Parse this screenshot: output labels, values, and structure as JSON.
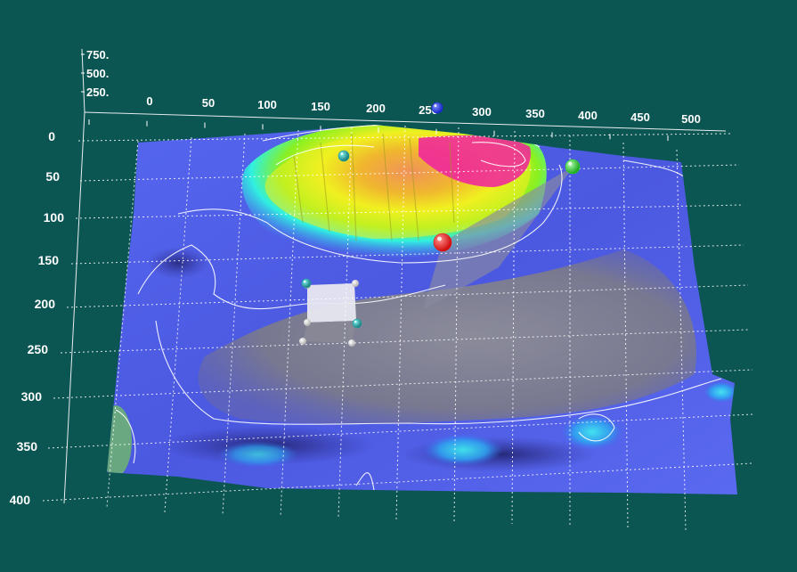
{
  "chart_data": {
    "type": "surface3d",
    "x_ticks": [
      "0",
      "50",
      "100",
      "150",
      "200",
      "250",
      "300",
      "350",
      "400",
      "450",
      "500"
    ],
    "y_ticks": [
      "0",
      "50",
      "100",
      "150",
      "200",
      "250",
      "300",
      "350",
      "400"
    ],
    "z_ticks": [
      "250.",
      "500.",
      "750."
    ],
    "x_range": [
      0,
      500
    ],
    "y_range": [
      0,
      400
    ],
    "z_range": [
      0,
      750
    ],
    "grid": true,
    "colormap": [
      "#4d5ef0",
      "#3aa8f0",
      "#2ff0e0",
      "#7df020",
      "#f0f020",
      "#f09020",
      "#f020a0"
    ],
    "markers": [
      {
        "name": "cyan-marker-1",
        "color": "#1aa6a0"
      },
      {
        "name": "blue-marker",
        "color": "#1a2ce6"
      },
      {
        "name": "green-marker",
        "color": "#22dd22"
      },
      {
        "name": "red-marker",
        "color": "#ee1010"
      },
      {
        "name": "cyan-marker-2",
        "color": "#1aa6a0"
      },
      {
        "name": "cyan-marker-3",
        "color": "#1aa6a0"
      }
    ]
  }
}
